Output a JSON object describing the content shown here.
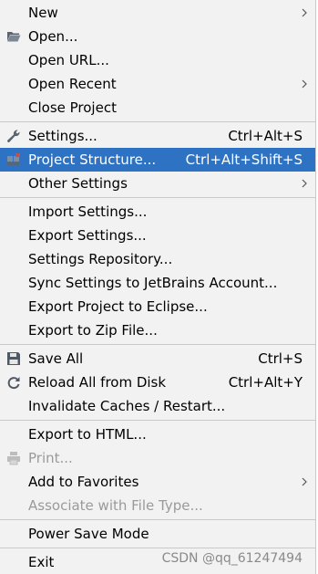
{
  "menu": {
    "new": "New",
    "open": "Open...",
    "open_url": "Open URL...",
    "open_recent": "Open Recent",
    "close_project": "Close Project",
    "settings": "Settings...",
    "settings_shortcut": "Ctrl+Alt+S",
    "project_structure": "Project Structure...",
    "project_structure_shortcut": "Ctrl+Alt+Shift+S",
    "other_settings": "Other Settings",
    "import_settings": "Import Settings...",
    "export_settings": "Export Settings...",
    "settings_repository": "Settings Repository...",
    "sync_settings": "Sync Settings to JetBrains Account...",
    "export_eclipse": "Export Project to Eclipse...",
    "export_zip": "Export to Zip File...",
    "save_all": "Save All",
    "save_all_shortcut": "Ctrl+S",
    "reload_all": "Reload All from Disk",
    "reload_all_shortcut": "Ctrl+Alt+Y",
    "invalidate_caches": "Invalidate Caches / Restart...",
    "export_html": "Export to HTML...",
    "print": "Print...",
    "add_favorites": "Add to Favorites",
    "associate_file_type": "Associate with File Type...",
    "power_save": "Power Save Mode",
    "exit": "Exit"
  },
  "watermark": "CSDN @qq_61247494",
  "colors": {
    "highlight": "#2e73c3",
    "background": "#f2f2f2",
    "disabled": "#9a9a9a"
  }
}
